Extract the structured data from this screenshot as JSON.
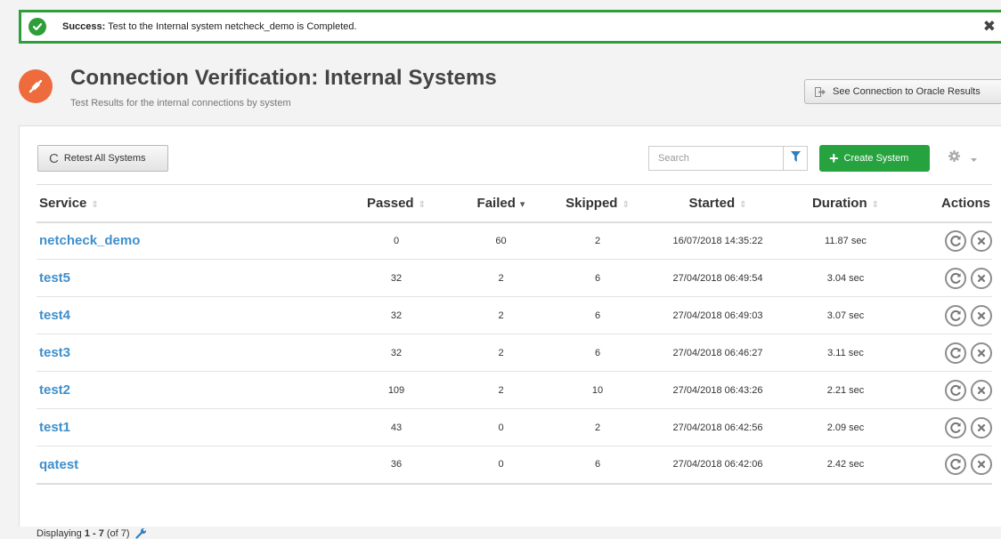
{
  "alert": {
    "prefix": "Success:",
    "message": "Test to the Internal system netcheck_demo is Completed.",
    "close": "✖",
    "color": "#2f9e3a"
  },
  "header": {
    "title": "Connection Verification: Internal Systems",
    "subtitle": "Test Results for the internal connections by system",
    "icon": "connection-plug-icon",
    "icon_color": "#ed6b3c",
    "oracle_button": "See Connection to Oracle Results"
  },
  "toolbar": {
    "retest_label": "Retest All Systems",
    "search_placeholder": "Search",
    "create_label": "Create System",
    "create_color": "#26a33f"
  },
  "table": {
    "columns": {
      "service": "Service",
      "passed": "Passed",
      "failed": "Failed",
      "skipped": "Skipped",
      "started": "Started",
      "duration": "Duration",
      "actions": "Actions"
    },
    "sorted_column": "failed",
    "rows": [
      {
        "service": "netcheck_demo",
        "passed": "0",
        "failed": "60",
        "skipped": "2",
        "started": "16/07/2018 14:35:22",
        "duration": "11.87 sec"
      },
      {
        "service": "test5",
        "passed": "32",
        "failed": "2",
        "skipped": "6",
        "started": "27/04/2018 06:49:54",
        "duration": "3.04 sec"
      },
      {
        "service": "test4",
        "passed": "32",
        "failed": "2",
        "skipped": "6",
        "started": "27/04/2018 06:49:03",
        "duration": "3.07 sec"
      },
      {
        "service": "test3",
        "passed": "32",
        "failed": "2",
        "skipped": "6",
        "started": "27/04/2018 06:46:27",
        "duration": "3.11 sec"
      },
      {
        "service": "test2",
        "passed": "109",
        "failed": "2",
        "skipped": "10",
        "started": "27/04/2018 06:43:26",
        "duration": "2.21 sec"
      },
      {
        "service": "test1",
        "passed": "43",
        "failed": "0",
        "skipped": "2",
        "started": "27/04/2018 06:42:56",
        "duration": "2.09 sec"
      },
      {
        "service": "qatest",
        "passed": "36",
        "failed": "0",
        "skipped": "6",
        "started": "27/04/2018 06:42:06",
        "duration": "2.42 sec"
      }
    ]
  },
  "footer": {
    "prefix": "Displaying",
    "range": "1 - 7",
    "total": "(of 7)"
  }
}
